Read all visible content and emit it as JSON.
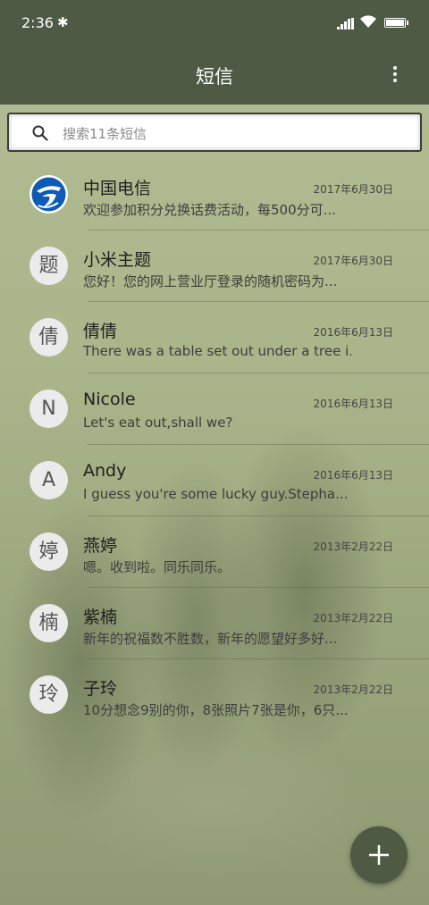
{
  "status_bar": {
    "time": "2:36",
    "bluetooth_glyph": "✱"
  },
  "header": {
    "title": "短信"
  },
  "search": {
    "placeholder": "搜索11条短信"
  },
  "conversations": [
    {
      "avatar": "",
      "avatar_icon": "china-telecom-logo",
      "name": "中国电信",
      "date": "2017年6月30日",
      "preview": "欢迎参加积分兑换话费活动，每500分可..."
    },
    {
      "avatar": "题",
      "name": "小米主题",
      "date": "2017年6月30日",
      "preview": "您好！您的网上营业厅登录的随机密码为..."
    },
    {
      "avatar": "倩",
      "name": "倩倩",
      "date": "2016年6月13日",
      "preview": "There was a table set out under a tree i..."
    },
    {
      "avatar": "N",
      "name": "Nicole",
      "date": "2016年6月13日",
      "preview": "Let's eat out,shall we?"
    },
    {
      "avatar": "A",
      "name": "Andy",
      "date": "2016年6月13日",
      "preview": "I guess you're some lucky guy.Stepha..."
    },
    {
      "avatar": "婷",
      "name": "燕婷",
      "date": "2013年2月22日",
      "preview": "嗯。收到啦。同乐同乐。"
    },
    {
      "avatar": "楠",
      "name": "紫楠",
      "date": "2013年2月22日",
      "preview": "新年的祝福数不胜数，新年的愿望好多好..."
    },
    {
      "avatar": "玲",
      "name": "子玲",
      "date": "2013年2月22日",
      "preview": "10分想念9别的你，8张照片7张是你，6只..."
    }
  ],
  "colors": {
    "header": "#4f5a45",
    "fab": "#4f5a45",
    "background": "#aab58a"
  },
  "fab": {
    "icon": "plus-icon"
  }
}
